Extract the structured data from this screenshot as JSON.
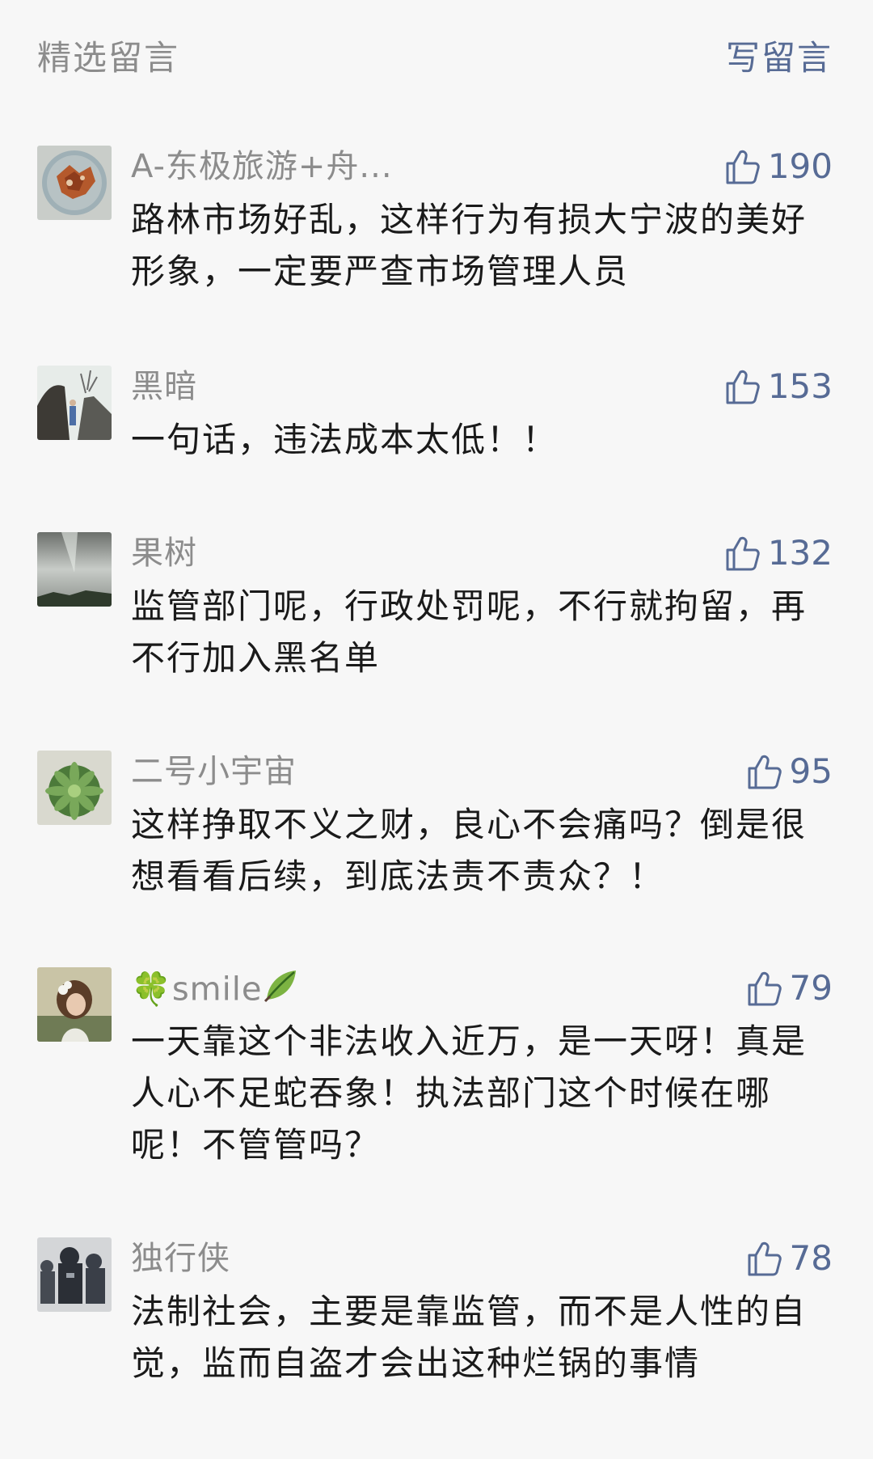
{
  "header": {
    "title": "精选留言",
    "write_label": "写留言"
  },
  "comments": [
    {
      "nickname": "A-东极旅游+舟...",
      "likes": "190",
      "content": "路林市场好乱，这样行为有损大宁波的美好形象，一定要严查市场管理人员"
    },
    {
      "nickname": "黑暗",
      "likes": "153",
      "content": "一句话，违法成本太低！！"
    },
    {
      "nickname": "果树",
      "likes": "132",
      "content": "监管部门呢，行政处罚呢，不行就拘留，再不行加入黑名单"
    },
    {
      "nickname": "二号小宇宙",
      "likes": "95",
      "content": "这样挣取不义之财，良心不会痛吗？倒是很想看看后续，到底法责不责众？！"
    },
    {
      "nickname": "smile",
      "nickname_prefix": "🍀",
      "nickname_suffix_icon": "leaf-icon",
      "likes": "79",
      "content": "一天靠这个非法收入近万，是一天呀！真是人心不足蛇吞象！执法部门这个时候在哪呢！不管管吗？"
    },
    {
      "nickname": "独行侠",
      "likes": "78",
      "content": "法制社会，主要是靠监管，而不是人性的自觉，监而自盗才会出这种烂锅的事情"
    }
  ],
  "colors": {
    "background": "#f7f7f7",
    "link": "#576b95",
    "muted": "#8c8c8c",
    "text": "#1a1a1a"
  },
  "icons": {
    "like": "thumbs-up-icon"
  }
}
